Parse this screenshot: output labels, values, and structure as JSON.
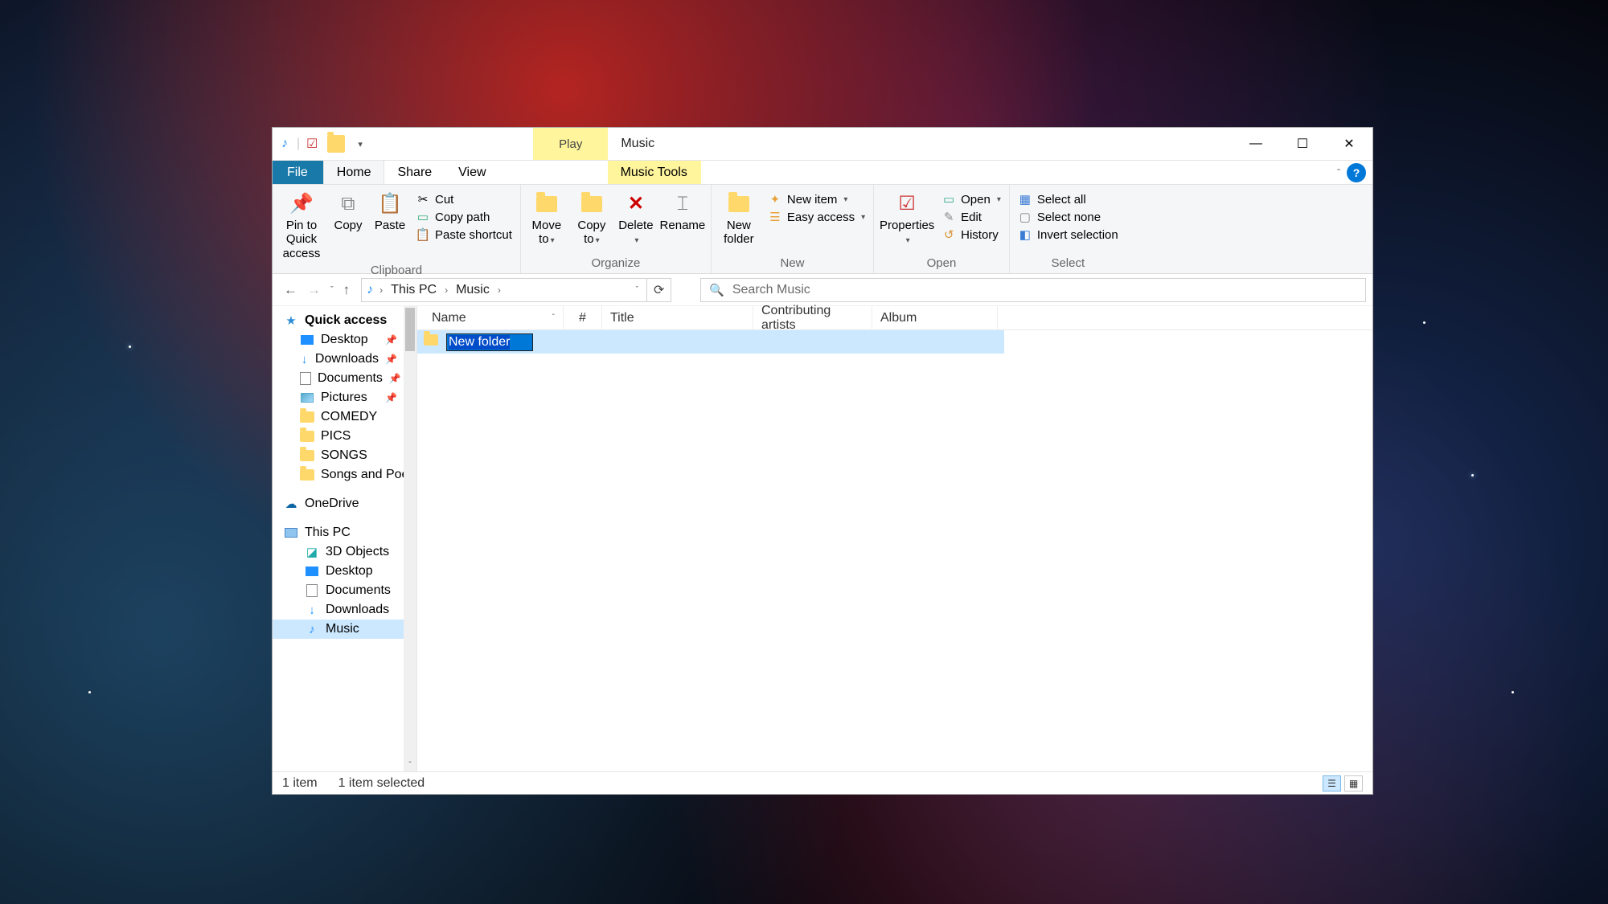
{
  "window": {
    "title": "Music"
  },
  "contextual_tab": {
    "play": "Play",
    "tools": "Music Tools"
  },
  "tabs": {
    "file": "File",
    "home": "Home",
    "share": "Share",
    "view": "View"
  },
  "ribbon": {
    "clipboard": {
      "label": "Clipboard",
      "pin": "Pin to Quick access",
      "copy": "Copy",
      "paste": "Paste",
      "cut": "Cut",
      "copy_path": "Copy path",
      "paste_shortcut": "Paste shortcut"
    },
    "organize": {
      "label": "Organize",
      "move_to": "Move to",
      "copy_to": "Copy to",
      "delete": "Delete",
      "rename": "Rename"
    },
    "new": {
      "label": "New",
      "new_folder": "New folder",
      "new_item": "New item",
      "easy_access": "Easy access"
    },
    "open": {
      "label": "Open",
      "properties": "Properties",
      "open": "Open",
      "edit": "Edit",
      "history": "History"
    },
    "select": {
      "label": "Select",
      "select_all": "Select all",
      "select_none": "Select none",
      "invert": "Invert selection"
    }
  },
  "breadcrumb": {
    "this_pc": "This PC",
    "music": "Music"
  },
  "search": {
    "placeholder": "Search Music"
  },
  "nav": {
    "quick_access": "Quick access",
    "desktop": "Desktop",
    "downloads": "Downloads",
    "documents": "Documents",
    "pictures": "Pictures",
    "comedy": "COMEDY",
    "pics": "PICS",
    "songs": "SONGS",
    "songs_poem": "Songs and Poem",
    "onedrive": "OneDrive",
    "this_pc": "This PC",
    "objects3d": "3D Objects",
    "music": "Music"
  },
  "columns": {
    "name": "Name",
    "num": "#",
    "title": "Title",
    "artist": "Contributing artists",
    "album": "Album"
  },
  "rows": [
    {
      "name": "New folder"
    }
  ],
  "status": {
    "count": "1 item",
    "selected": "1 item selected"
  }
}
